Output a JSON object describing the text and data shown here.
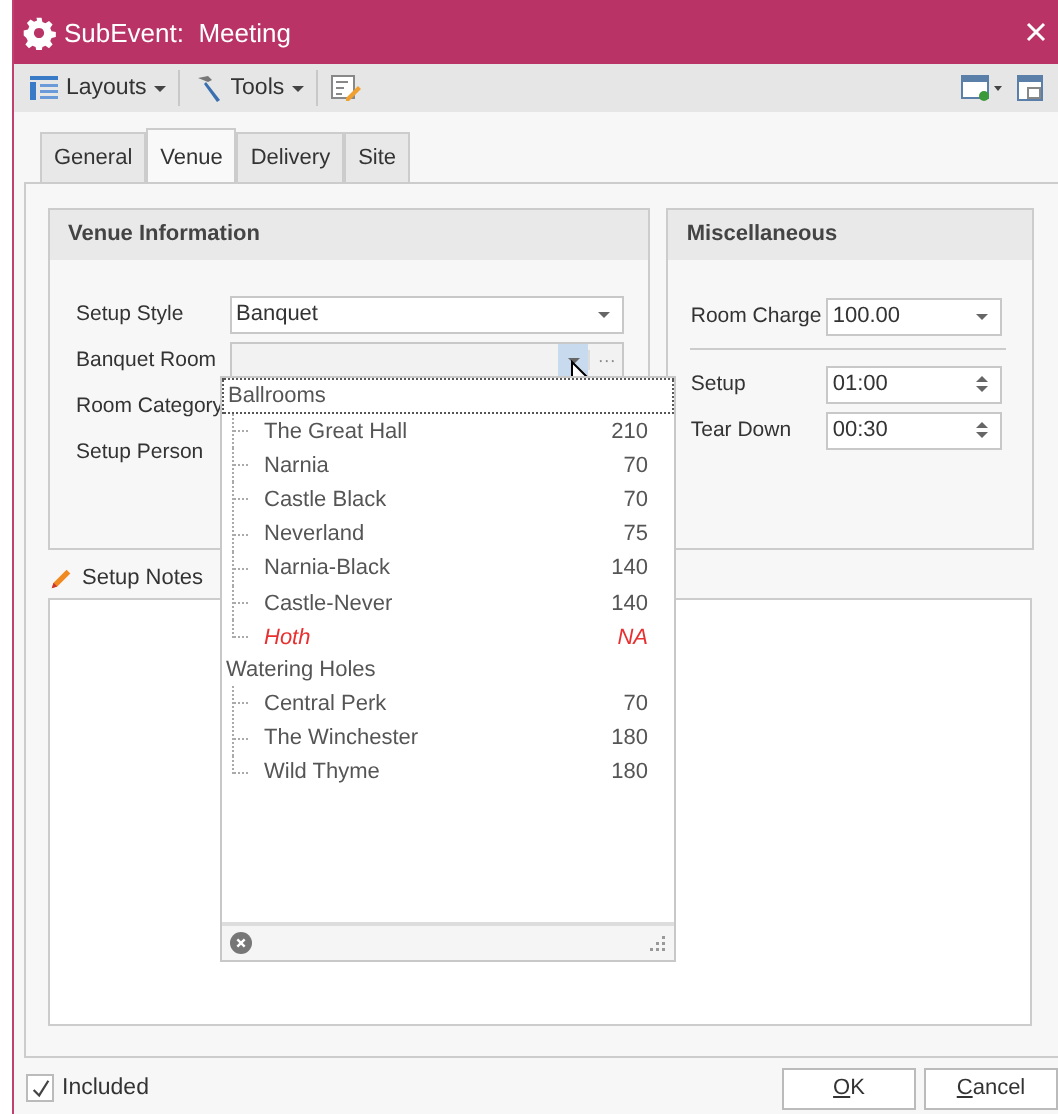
{
  "window": {
    "title": "SubEvent:  Meeting"
  },
  "toolbar": {
    "layouts": "Layouts",
    "tools": "Tools"
  },
  "tabs": [
    {
      "label": "General",
      "selected": false
    },
    {
      "label": "Venue",
      "selected": true
    },
    {
      "label": "Delivery",
      "selected": false
    },
    {
      "label": "Site",
      "selected": false
    }
  ],
  "venue_information": {
    "title": "Venue Information",
    "fields": [
      {
        "label": "Setup Style",
        "value": "Banquet",
        "kind": "dropdown"
      },
      {
        "label": "Banquet Room",
        "kind": "open_dropdown",
        "browse_button": "···"
      },
      {
        "label": "Room Category",
        "kind": "hidden"
      },
      {
        "label": "Setup Person",
        "kind": "hidden"
      }
    ]
  },
  "miscellaneous": {
    "title": "Miscellaneous",
    "room_charge": {
      "label": "Room Charge",
      "value": "100.00"
    },
    "times": [
      {
        "label": "Setup",
        "value": "01:00"
      },
      {
        "label": "Tear Down",
        "value": "00:30"
      }
    ]
  },
  "setup_notes": {
    "label": "Setup Notes"
  },
  "room_dropdown": {
    "groups": [
      {
        "name": "Ballrooms",
        "children": [
          {
            "name": "The Great Hall",
            "capacity": "210",
            "unavailable": false
          },
          {
            "name": "Narnia",
            "capacity": "70",
            "unavailable": false
          },
          {
            "name": "Castle Black",
            "capacity": "70",
            "unavailable": false
          },
          {
            "name": "Neverland",
            "capacity": "75",
            "unavailable": false
          },
          {
            "name": "Narnia-Black",
            "capacity": "140",
            "unavailable": false
          },
          {
            "name": "Castle-Never",
            "capacity": "140",
            "unavailable": false
          },
          {
            "name": "Hoth",
            "capacity": "NA",
            "unavailable": true
          }
        ]
      },
      {
        "name": "Watering Holes",
        "children": [
          {
            "name": "Central Perk",
            "capacity": "70",
            "unavailable": false
          },
          {
            "name": "The Winchester",
            "capacity": "180",
            "unavailable": false
          },
          {
            "name": "Wild Thyme",
            "capacity": "180",
            "unavailable": false
          }
        ]
      }
    ]
  },
  "footer": {
    "included": {
      "label": "Included",
      "checked": true
    },
    "buttons": [
      {
        "label": "OK",
        "underline_first": true
      },
      {
        "label": "Cancel",
        "underline_first": true
      }
    ]
  }
}
